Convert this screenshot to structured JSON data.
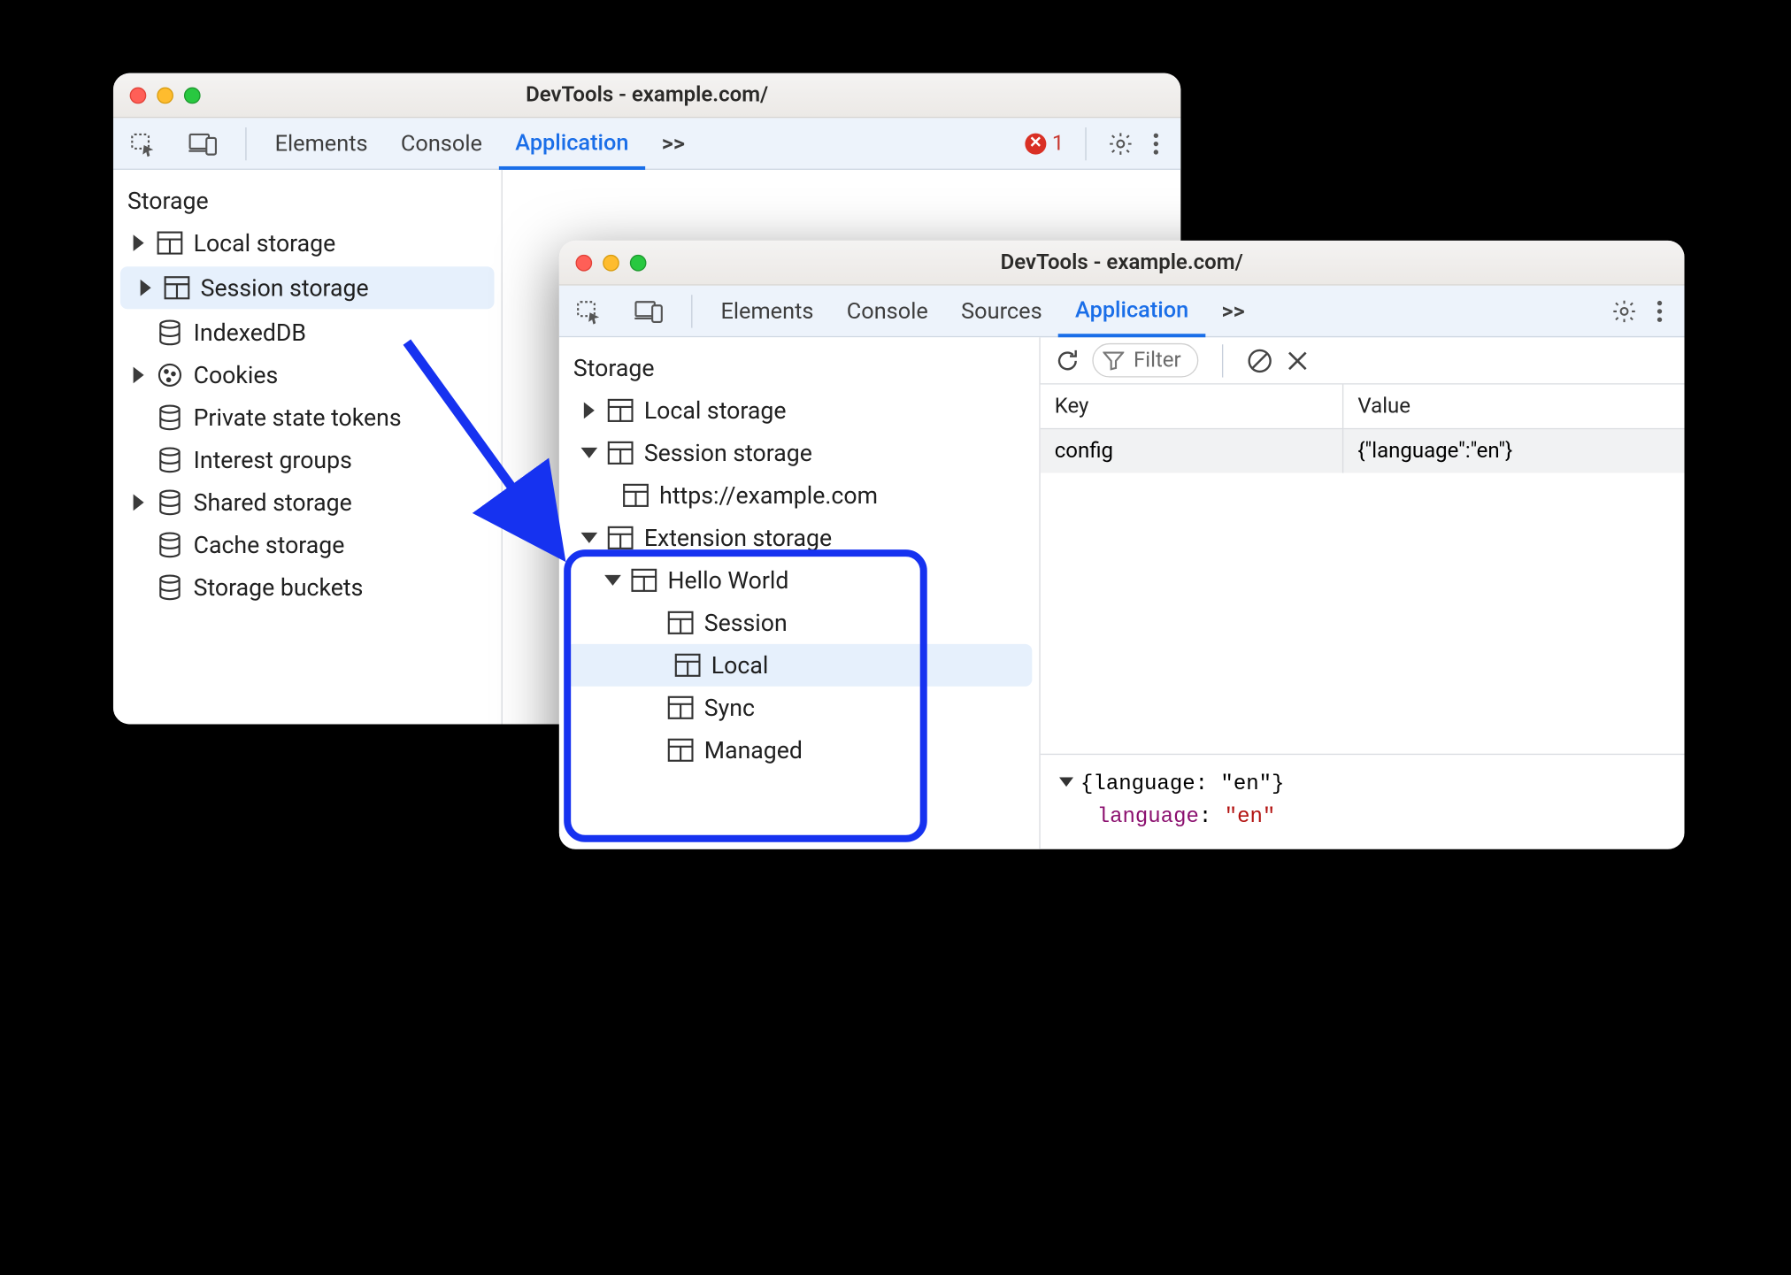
{
  "windowA": {
    "title": "DevTools - example.com/",
    "tabs": [
      "Elements",
      "Console",
      "Application"
    ],
    "activeTab": "Application",
    "moreGlyph": ">>",
    "errorCount": "1",
    "storageHeading": "Storage",
    "items": {
      "local": "Local storage",
      "session": "Session storage",
      "indexeddb": "IndexedDB",
      "cookies": "Cookies",
      "pst": "Private state tokens",
      "interest": "Interest groups",
      "shared": "Shared storage",
      "cache": "Cache storage",
      "buckets": "Storage buckets"
    }
  },
  "windowB": {
    "title": "DevTools - example.com/",
    "tabs": [
      "Elements",
      "Console",
      "Sources",
      "Application"
    ],
    "activeTab": "Application",
    "moreGlyph": ">>",
    "storageHeading": "Storage",
    "items": {
      "local": "Local storage",
      "session": "Session storage",
      "sessionChild": "https://example.com",
      "ext": "Extension storage",
      "extChild": "Hello World",
      "extSession": "Session",
      "extLocal": "Local",
      "extSync": "Sync",
      "extManaged": "Managed"
    },
    "filterPlaceholder": "Filter",
    "table": {
      "keyHeader": "Key",
      "valueHeader": "Value",
      "rows": [
        {
          "key": "config",
          "value": "{\"language\":\"en\"}"
        }
      ]
    },
    "inspector": {
      "summary": "{language: \"en\"}",
      "propKey": "language",
      "propVal": "\"en\""
    }
  }
}
